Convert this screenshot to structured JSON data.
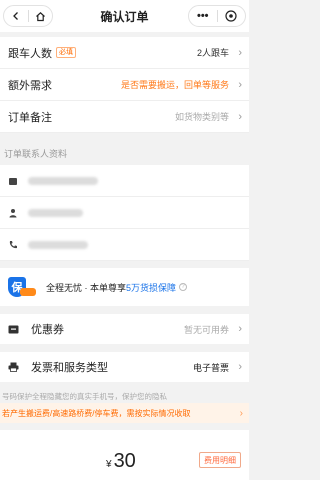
{
  "header": {
    "title": "确认订单"
  },
  "order": {
    "rows": [
      {
        "label": "跟车人数",
        "tag": "必填",
        "value": "2人跟车"
      },
      {
        "label": "额外需求",
        "value": "是否需要搬运，回单等服务"
      },
      {
        "label": "订单备注",
        "value": "如货物类别等"
      }
    ]
  },
  "contact": {
    "section_title": "订单联系人资料"
  },
  "promo": {
    "text": "全程无忧 · 本单尊享",
    "highlight": "5万货损保障",
    "info": "?"
  },
  "coupon": {
    "label": "优惠券",
    "value": "暂无可用券"
  },
  "invoice": {
    "label": "发票和服务类型",
    "value": "电子普票"
  },
  "privacy": {
    "text": "号码保护全程隐藏您的真实手机号，保护您的隐私"
  },
  "notice": {
    "text": "若产生搬运费/高速路桥费/停车费，需按实际情况收取"
  },
  "bottom": {
    "currency": "¥",
    "amount": "30",
    "fee_button": "费用明细"
  },
  "colors": {
    "accent": "#ff6a00",
    "brand_blue": "#1a73e8"
  }
}
